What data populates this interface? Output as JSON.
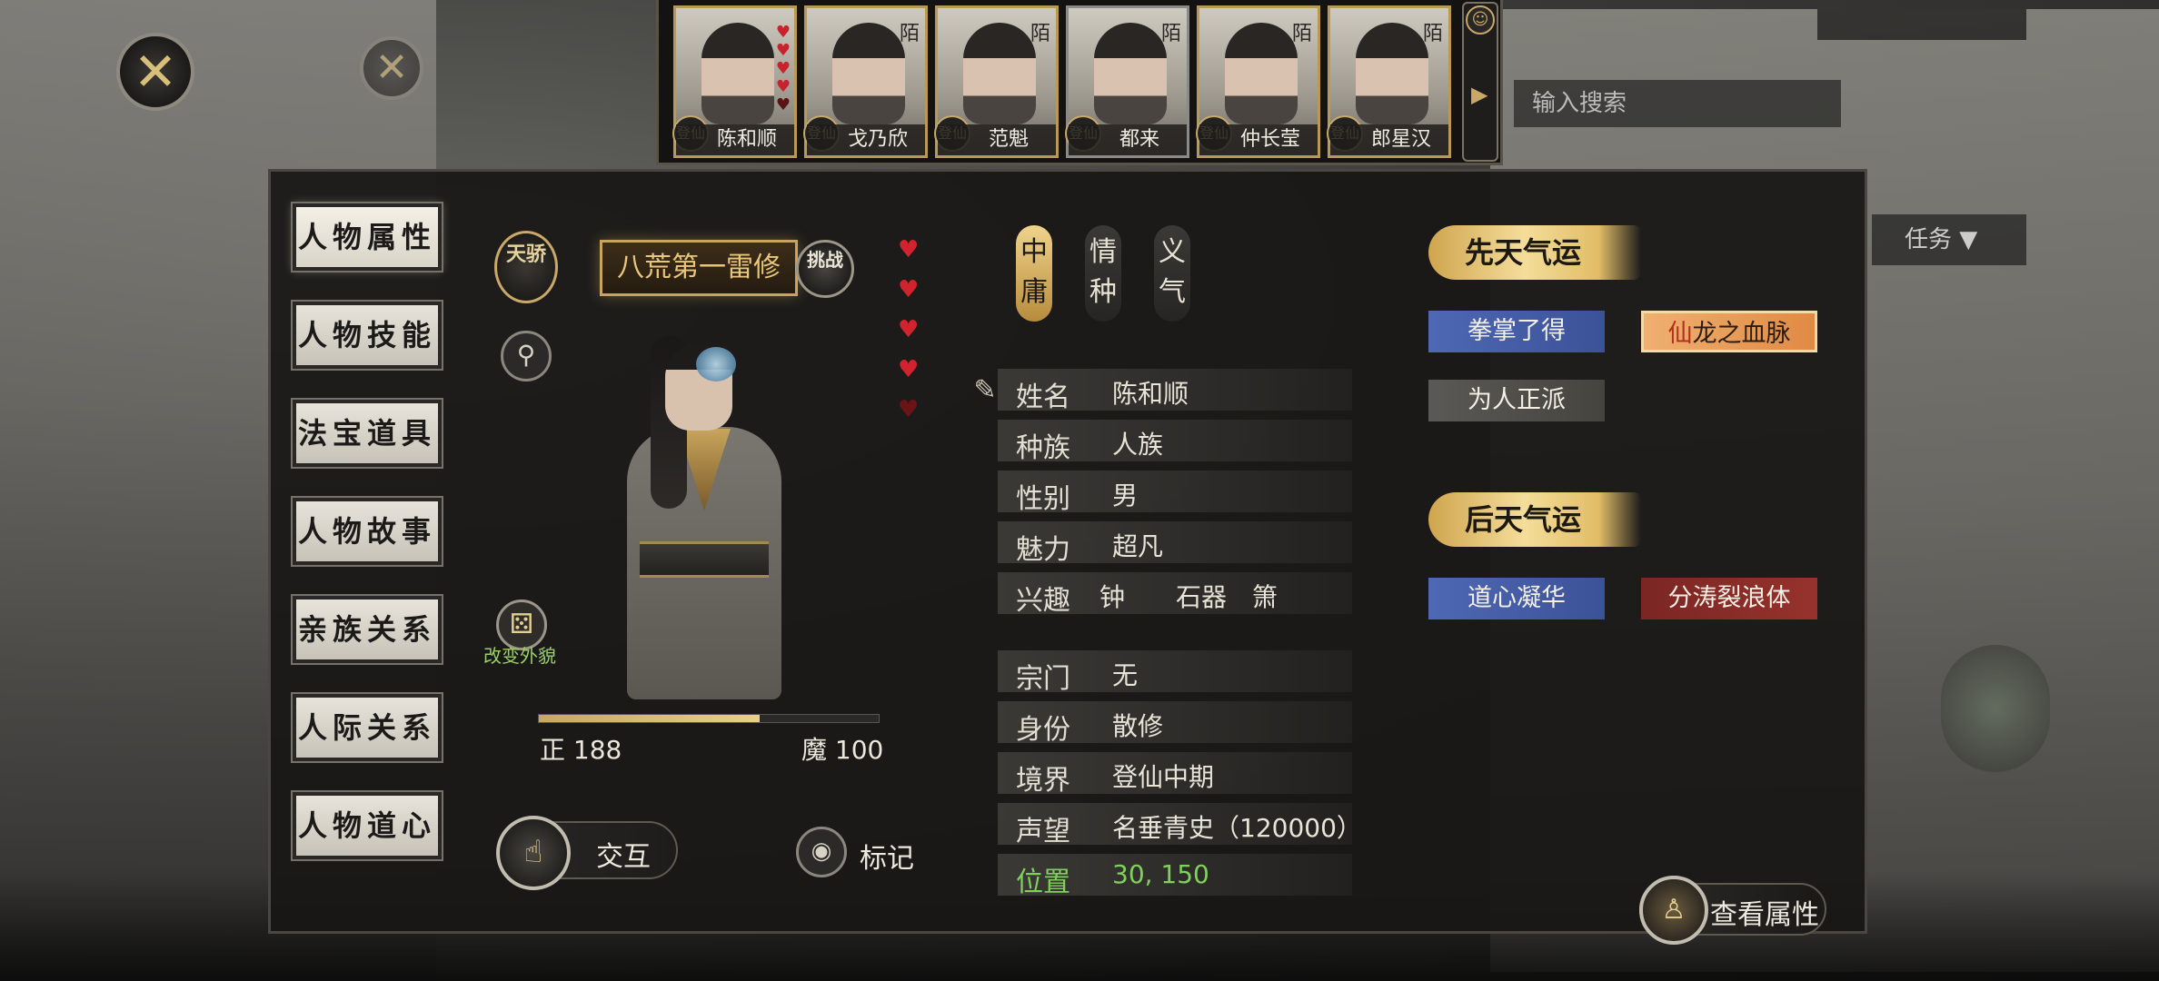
{
  "top_bar": {
    "characters": [
      {
        "name": "陈和顺",
        "tag": "",
        "badge": "登仙",
        "hearts": 5
      },
      {
        "name": "戈乃欣",
        "tag": "陌",
        "badge": "登仙",
        "hearts": 0
      },
      {
        "name": "范魁",
        "tag": "陌",
        "badge": "登仙",
        "hearts": 0
      },
      {
        "name": "都来",
        "tag": "陌",
        "badge": "登仙",
        "hearts": 0
      },
      {
        "name": "仲长莹",
        "tag": "陌",
        "badge": "登仙",
        "hearts": 0
      },
      {
        "name": "郎星汉",
        "tag": "陌",
        "badge": "登仙",
        "hearts": 0
      }
    ],
    "scroll_arrow": "▶",
    "people_icon": "people-icon"
  },
  "menu": {
    "items": [
      "人物属性",
      "人物技能",
      "法宝道具",
      "人物故事",
      "亲族关系",
      "人际关系",
      "人物道心"
    ]
  },
  "portrait": {
    "rank_badge": "天骄",
    "title": "八荒第一雷修",
    "challenge": "挑战",
    "change_look": "改变外貌",
    "zheng_label": "正 188",
    "mo_label": "魔 100",
    "zheng_value": 188,
    "mo_value": 100,
    "morality_fraction": 0.65,
    "hearts": [
      "♥",
      "♥",
      "♥",
      "♥",
      "♥"
    ]
  },
  "traits": [
    "中庸",
    "情种",
    "义气"
  ],
  "info": {
    "name_key": "姓名",
    "name_val": "陈和顺",
    "race_key": "种族",
    "race_val": "人族",
    "gender_key": "性别",
    "gender_val": "男",
    "charm_key": "魅力",
    "charm_val": "超凡",
    "hobby_key": "兴趣",
    "hobby_val": "钟　　石器　箫",
    "sect_key": "宗门",
    "sect_val": "无",
    "identity_key": "身份",
    "identity_val": "散修",
    "realm_key": "境界",
    "realm_val": "登仙中期",
    "fame_key": "声望",
    "fame_val": "名垂青史（120000）",
    "position_key": "位置",
    "position_val": "30, 150"
  },
  "fortune": {
    "innate_title": "先天气运",
    "innate": [
      "拳掌了得",
      "龙之血脉",
      "为人正派"
    ],
    "innate_prefix": "仙",
    "acquired_title": "后天气运",
    "acquired": [
      "道心凝华",
      "分涛裂浪体"
    ]
  },
  "actions": {
    "interact": "交互",
    "mark": "标记",
    "view_attributes": "查看属性"
  },
  "background": {
    "search_placeholder": "输入搜索",
    "dropdown": "任务 ▼"
  },
  "colors": {
    "gold": "#c9a868",
    "blue_chip": "#4f68b4",
    "orange_chip": "#e08a44",
    "red_chip": "#96322c",
    "position_green": "#7fd15c",
    "heart_red": "#d0232e"
  }
}
